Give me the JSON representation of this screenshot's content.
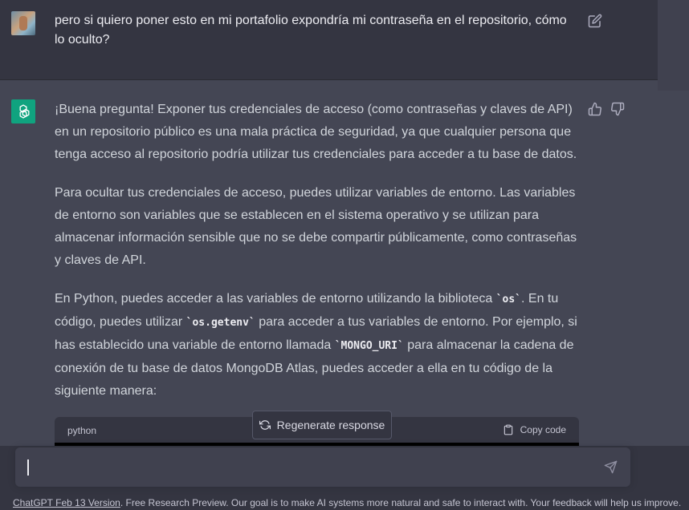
{
  "user_message": {
    "text": "pero si quiero poner esto en mi portafolio expondría mi contraseña en el repositorio, cómo lo oculto?",
    "avatar_icon": "user-photo-avatar",
    "edit_icon": "pencil-square-icon"
  },
  "assistant_message": {
    "avatar_icon": "openai-logo-icon",
    "p1": "¡Buena pregunta! Exponer tus credenciales de acceso (como contraseñas y claves de API) en un repositorio público es una mala práctica de seguridad, ya que cualquier persona que tenga acceso al repositorio podría utilizar tus credenciales para acceder a tu base de datos.",
    "p2": "Para ocultar tus credenciales de acceso, puedes utilizar variables de entorno. Las variables de entorno son variables que se establecen en el sistema operativo y se utilizan para almacenar información sensible que no se debe compartir públicamente, como contraseñas y claves de API.",
    "p3_a": "En Python, puedes acceder a las variables de entorno utilizando la biblioteca ",
    "p3_code1": "`os`",
    "p3_b": ". En tu código, puedes utilizar ",
    "p3_code2": "`os.getenv`",
    "p3_c": " para acceder a tus variables de entorno. Por ejemplo, si has establecido una variable de entorno llamada ",
    "p3_code3": "`MONGO_URI`",
    "p3_d": " para almacenar la cadena de conexión de tu base de datos MongoDB Atlas, puedes acceder a ella en tu código de la siguiente manera:"
  },
  "code_block": {
    "language": "python",
    "copy_label": "Copy code"
  },
  "regenerate_label": "Regenerate response",
  "input": {
    "value": "",
    "send_icon": "paper-plane-icon"
  },
  "footer": {
    "version_link": "ChatGPT Feb 13 Version",
    "text": ". Free Research Preview. Our goal is to make AI systems more natural and safe to interact with. Your feedback will help us improve."
  },
  "colors": {
    "bg_user": "#343541",
    "bg_assistant": "#444654",
    "accent": "#10a37f"
  }
}
